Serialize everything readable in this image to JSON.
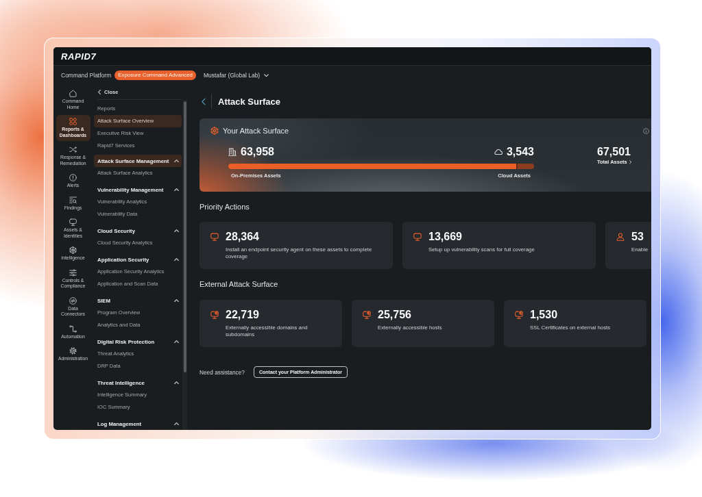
{
  "logo": "RAPID7",
  "context_bar": {
    "platform": "Command Platform",
    "edition_badge": "Exposure Command Advanced",
    "organization": "Mustafar (Global Lab)"
  },
  "rail": [
    {
      "label": "Command Home",
      "selected": false
    },
    {
      "label": "Reports & Dashboards",
      "selected": true
    },
    {
      "label": "Response & Remediation",
      "selected": false
    },
    {
      "label": "Alerts",
      "selected": false
    },
    {
      "label": "Findings",
      "selected": false
    },
    {
      "label": "Assets & Identities",
      "selected": false
    },
    {
      "label": "Intelligence",
      "selected": false
    },
    {
      "label": "Controls & Compliance",
      "selected": false
    },
    {
      "label": "Data Connectors",
      "selected": false
    },
    {
      "label": "Automation",
      "selected": false
    },
    {
      "label": "Administration",
      "selected": false
    }
  ],
  "nav_panel": {
    "close_label": "Close",
    "items": [
      {
        "label": "Reports",
        "selected": false
      },
      {
        "label": "Attack Surface Overview",
        "selected": true
      },
      {
        "label": "Executive Risk View",
        "selected": false
      },
      {
        "label": "Rapid7 Services",
        "selected": false
      }
    ],
    "sections": [
      {
        "title": "Attack Surface Management",
        "selected": true,
        "expanded": true,
        "items": [
          {
            "label": "Attack Surface Analytics",
            "selected": false
          }
        ]
      },
      {
        "title": "Vulnerability Management",
        "selected": false,
        "expanded": true,
        "items": [
          {
            "label": "Vulnerability Analytics",
            "selected": false
          },
          {
            "label": "Vulnerability Data",
            "selected": false
          }
        ]
      },
      {
        "title": "Cloud Security",
        "selected": false,
        "expanded": true,
        "items": [
          {
            "label": "Cloud Security Analytics",
            "selected": false
          }
        ]
      },
      {
        "title": "Application Security",
        "selected": false,
        "expanded": true,
        "items": [
          {
            "label": "Application Security Analytics",
            "selected": false
          },
          {
            "label": "Application and Scan Data",
            "selected": false
          }
        ]
      },
      {
        "title": "SIEM",
        "selected": false,
        "expanded": true,
        "items": [
          {
            "label": "Program Overview",
            "selected": false
          },
          {
            "label": "Analytics and Data",
            "selected": false
          }
        ]
      },
      {
        "title": "Digital Risk Protection",
        "selected": false,
        "expanded": true,
        "items": [
          {
            "label": "Threat Analytics",
            "selected": false
          },
          {
            "label": "DRP Data",
            "selected": false
          }
        ]
      },
      {
        "title": "Threat Intelligence",
        "selected": false,
        "expanded": true,
        "items": [
          {
            "label": "Intelligence Summary",
            "selected": false
          },
          {
            "label": "IOC Summary",
            "selected": false
          }
        ]
      },
      {
        "title": "Log Management",
        "selected": false,
        "expanded": true
      }
    ]
  },
  "page_header": {
    "title": "Attack Surface"
  },
  "attack_surface": {
    "title": "Your Attack Surface",
    "on_premises": {
      "value": "63,958",
      "label": "On-Premises Assets"
    },
    "cloud": {
      "value": "3,543",
      "label": "Cloud Assets"
    },
    "level": 0.946,
    "total": {
      "value": "67,501",
      "label": "Total Assets"
    }
  },
  "priority_actions": {
    "title": "Priority Actions",
    "cards": [
      {
        "value": "28,364",
        "description": "Install an endpoint security agent on these assets to complete coverage"
      },
      {
        "value": "13,669",
        "description": "Setup up vulnerability scans for full coverage"
      },
      {
        "value": "53",
        "description": "Enable"
      }
    ]
  },
  "external_attack_surface": {
    "title": "External Attack Surface",
    "cards": [
      {
        "value": "22,719",
        "description": "Externally accessible domains and subdomains"
      },
      {
        "value": "25,756",
        "description": "Externally accessible hosts"
      },
      {
        "value": "1,530",
        "description": "SSL Certificates on external hosts"
      }
    ]
  },
  "assistance": {
    "text": "Need assistance?",
    "button": "Contact your Platform Administrator"
  }
}
